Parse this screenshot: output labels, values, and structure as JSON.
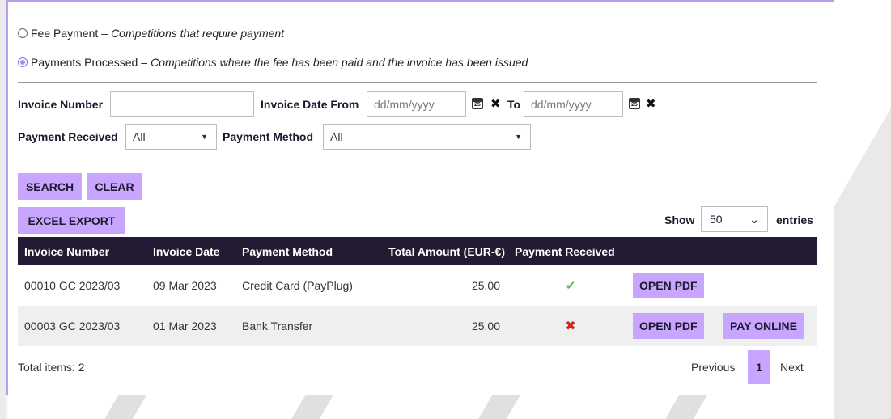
{
  "filters": {
    "fee_payment": {
      "label": "Fee Payment",
      "dash": "–",
      "desc": "Competitions that require payment",
      "checked": false
    },
    "payments_processed": {
      "label": "Payments Processed",
      "dash": "–",
      "desc": "Competitions where the fee has been paid and the invoice has been issued",
      "checked": true
    },
    "invoice_number_label": "Invoice Number",
    "invoice_number_value": "",
    "invoice_date_from_label": "Invoice Date From",
    "date_from_placeholder": "dd/mm/yyyy",
    "to_label": "To",
    "date_to_placeholder": "dd/mm/yyyy",
    "payment_received_label": "Payment Received",
    "payment_received_value": "All",
    "payment_method_label": "Payment Method",
    "payment_method_value": "All"
  },
  "buttons": {
    "search": "SEARCH",
    "clear": "CLEAR",
    "excel_export": "EXCEL EXPORT"
  },
  "entries": {
    "show_label": "Show",
    "value": "50",
    "entries_label": "entries"
  },
  "table": {
    "columns": [
      "Invoice Number",
      "Invoice Date",
      "Payment Method",
      "Total Amount (EUR-€)",
      "Payment Received"
    ],
    "rows": [
      {
        "invoice_number": "00010 GC 2023/03",
        "invoice_date": "09 Mar 2023",
        "payment_method": "Credit Card (PayPlug)",
        "total": "25.00",
        "received": "✔",
        "open_pdf": "OPEN PDF"
      },
      {
        "invoice_number": "00003 GC 2023/03",
        "invoice_date": "01 Mar 2023",
        "payment_method": "Bank Transfer",
        "total": "25.00",
        "received": "✖",
        "open_pdf": "OPEN PDF",
        "pay_online": "PAY ONLINE"
      }
    ]
  },
  "footer": {
    "total_items": "Total items: 2",
    "previous": "Previous",
    "current_page": "1",
    "next": "Next"
  },
  "icons": {
    "calendar_day": "25"
  },
  "colors": {
    "accent": "#c8a6ff",
    "header_bg": "#231b33",
    "success": "#5cb85c",
    "danger": "#d6201a"
  }
}
